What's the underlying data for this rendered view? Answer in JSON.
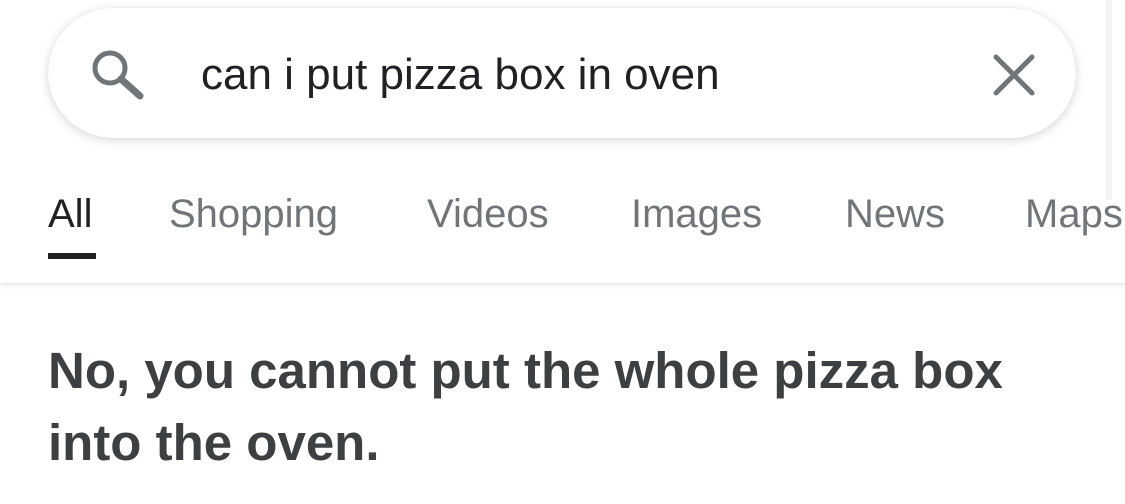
{
  "search": {
    "query": "can i put pizza box in oven",
    "icons": {
      "left": "search-icon",
      "right": "close-icon"
    }
  },
  "tabs": [
    {
      "label": "All",
      "active": true
    },
    {
      "label": "Shopping",
      "active": false
    },
    {
      "label": "Videos",
      "active": false
    },
    {
      "label": "Images",
      "active": false
    },
    {
      "label": "News",
      "active": false
    },
    {
      "label": "Maps",
      "active": false
    }
  ],
  "answer": {
    "text": "No, you cannot put the whole pizza box into the oven."
  },
  "colors": {
    "active_tab": "#202124",
    "inactive_tab": "#70757a",
    "answer_text": "#3c4043",
    "icon_gray": "#70757a"
  }
}
